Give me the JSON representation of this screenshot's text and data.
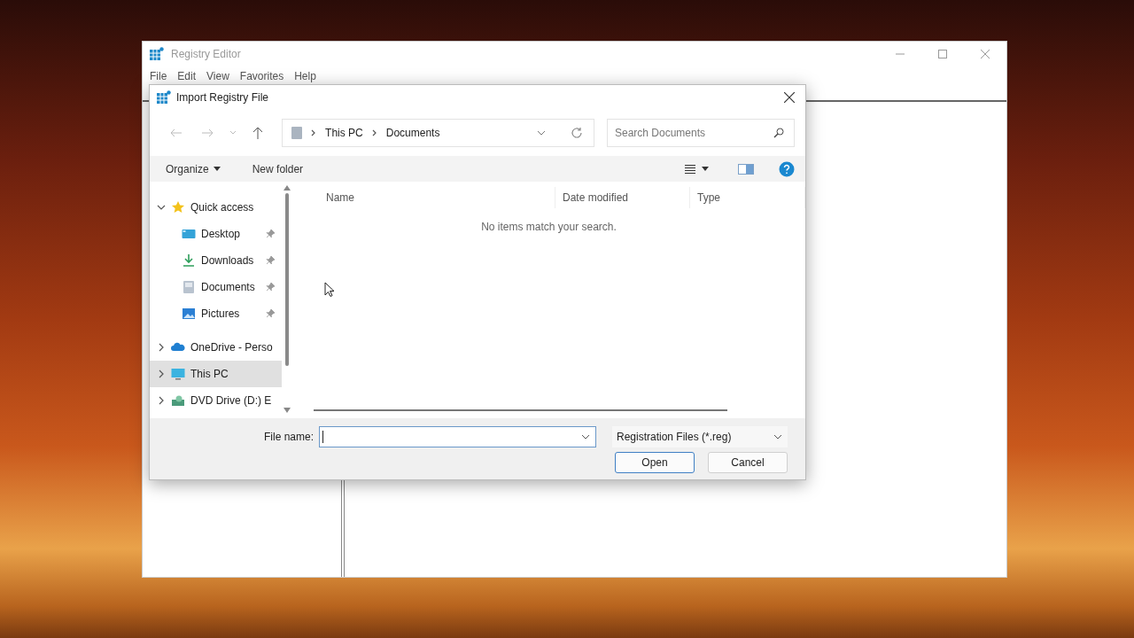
{
  "registry_window": {
    "title": "Registry Editor",
    "menu": [
      "File",
      "Edit",
      "View",
      "Favorites",
      "Help"
    ]
  },
  "dialog": {
    "title": "Import Registry File",
    "breadcrumb": [
      "This PC",
      "Documents"
    ],
    "search": {
      "placeholder": "Search Documents"
    },
    "commands": [
      "Organize",
      "New folder"
    ],
    "nav_items": [
      {
        "label": "Quick access",
        "kind": "star",
        "expanded": true,
        "selected": false,
        "children": [
          {
            "label": "Desktop",
            "kind": "desktop",
            "pinned": true,
            "selected": false
          },
          {
            "label": "Downloads",
            "kind": "download",
            "pinned": true,
            "selected": false
          },
          {
            "label": "Documents",
            "kind": "document",
            "pinned": true,
            "selected": false
          },
          {
            "label": "Pictures",
            "kind": "picture",
            "pinned": true,
            "selected": false
          }
        ]
      },
      {
        "label": "OneDrive - Perso",
        "kind": "cloud",
        "expanded": false,
        "selected": false
      },
      {
        "label": "This PC",
        "kind": "monitor",
        "expanded": false,
        "selected": true
      },
      {
        "label": "DVD Drive (D:) E",
        "kind": "drive",
        "expanded": false,
        "selected": false
      }
    ],
    "columns": [
      "Name",
      "Date modified",
      "Type"
    ],
    "empty_message": "No items match your search.",
    "file_name_label": "File name:",
    "file_type": "Registration Files (*.reg)",
    "buttons": [
      {
        "label": "Open",
        "default": true
      },
      {
        "label": "Cancel",
        "default": false
      }
    ]
  }
}
